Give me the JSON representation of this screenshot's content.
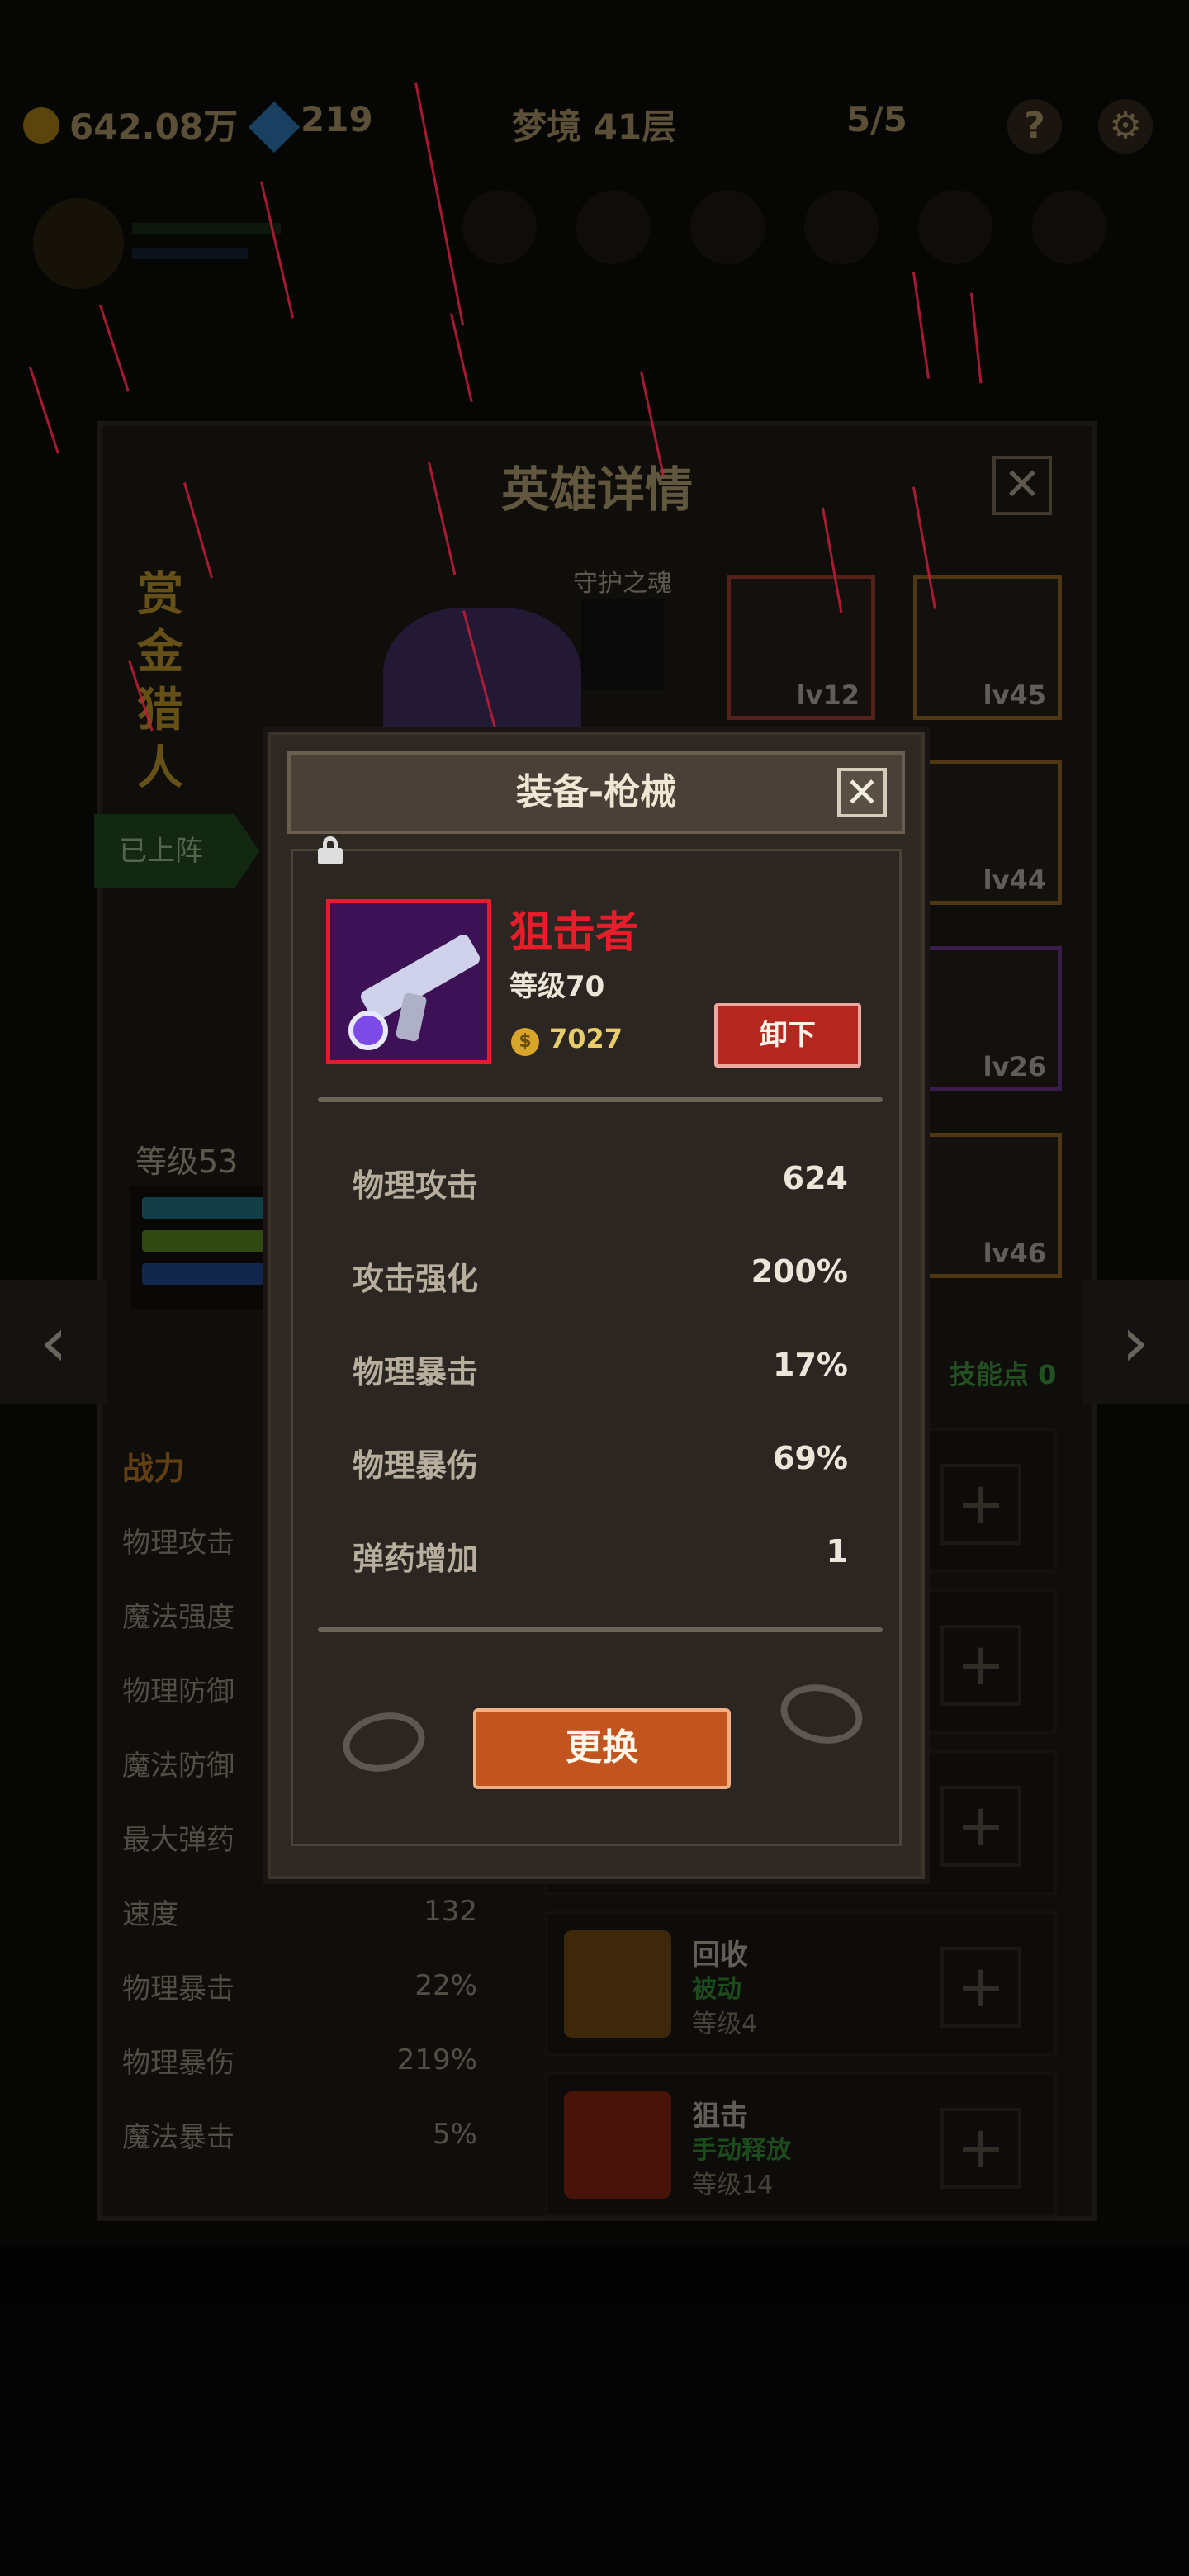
{
  "topbar": {
    "gold": "642.08万",
    "gems": "219",
    "dungeon": "梦境 41层",
    "keys": "5/5",
    "help_icon": "?"
  },
  "hero": {
    "title": "英雄详情",
    "close": "✕",
    "name": "赏金猎人",
    "status": "已上阵",
    "guard_label": "守护之魂",
    "level": "等级53",
    "equip_slots": [
      {
        "level": "lv12"
      },
      {
        "level": "lv45"
      },
      {
        "level": "lv44"
      },
      {
        "level": "lv26"
      },
      {
        "level": "lv46"
      }
    ],
    "skill_points": "技能点 0",
    "stats": [
      {
        "label": "战力",
        "value": ""
      },
      {
        "label": "物理攻击",
        "value": ""
      },
      {
        "label": "魔法强度",
        "value": ""
      },
      {
        "label": "物理防御",
        "value": ""
      },
      {
        "label": "魔法防御",
        "value": ""
      },
      {
        "label": "最大弹药",
        "value": ""
      },
      {
        "label": "速度",
        "value": "132"
      },
      {
        "label": "物理暴击",
        "value": "22%"
      },
      {
        "label": "物理暴伤",
        "value": "219%"
      },
      {
        "label": "魔法暴击",
        "value": "5%"
      }
    ],
    "skills": [
      {
        "name": "回收",
        "type": "被动",
        "level": "等级4"
      },
      {
        "name": "狙击",
        "type": "手动释放",
        "level": "等级14"
      }
    ]
  },
  "nav": {
    "prev": "‹",
    "next": "›"
  },
  "dialog": {
    "title": "装备-枪械",
    "close": "✕",
    "item_name": "狙击者",
    "item_level": "等级70",
    "coin_symbol": "$",
    "price": "7027",
    "unequip_label": "卸下",
    "stats": [
      {
        "label": "物理攻击",
        "value": "624"
      },
      {
        "label": "攻击强化",
        "value": "200%"
      },
      {
        "label": "物理暴击",
        "value": "17%"
      },
      {
        "label": "物理暴伤",
        "value": "69%"
      },
      {
        "label": "弹药增加",
        "value": "1"
      }
    ],
    "change_label": "更换"
  },
  "colors": {
    "item_name": "#e81d2a",
    "unequip_button": "#b5281f",
    "change_button": "#c2551f",
    "item_frame": "#e01f2c",
    "price": "#e8cc6a",
    "skill_points": "#4ab44a"
  }
}
